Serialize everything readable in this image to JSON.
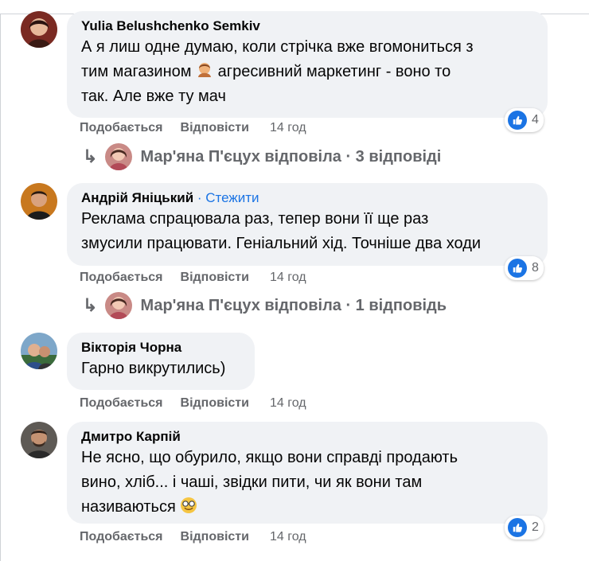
{
  "comments": [
    {
      "author": "Yulia Belushchenko Semkiv",
      "lines": [
        "А я лиш одне думаю, коли стрічка вже вгомониться з",
        "тим магазином ",
        " агресивний маркетинг - воно то",
        "так. Але вже ту мач"
      ],
      "like_label": "Подобається",
      "reply_label": "Відповісти",
      "time": "14 год",
      "reaction_count": "4",
      "replies_summary": "Мар'яна П'єцух відповіла · 3 відповіді"
    },
    {
      "author": "Андрій Яніцький",
      "follow_label": " · Стежити",
      "lines": [
        "Реклама спрацювала раз, тепер вони її ще раз",
        "змусили працювати. Геніальний хід. Точніше два ходи"
      ],
      "like_label": "Подобається",
      "reply_label": "Відповісти",
      "time": "14 год",
      "reaction_count": "8",
      "replies_summary": "Мар'яна П'єцух відповіла · 1 відповідь"
    },
    {
      "author": "Вікторія Чорна",
      "lines": [
        "Гарно викрутились)"
      ],
      "like_label": "Подобається",
      "reply_label": "Відповісти",
      "time": "14 год"
    },
    {
      "author": "Дмитро Карпій",
      "lines": [
        "Не ясно, що обурило, якщо вони справді продають",
        "вино, хліб... і чаші, звідки пити, чи як вони там",
        "називаються "
      ],
      "like_label": "Подобається",
      "reply_label": "Відповісти",
      "time": "14 год",
      "reaction_count": "2"
    }
  ],
  "colors": {
    "bubble": "#f0f2f5",
    "link": "#1b74e4",
    "meta": "#65676b",
    "like": "#1b74e4"
  }
}
